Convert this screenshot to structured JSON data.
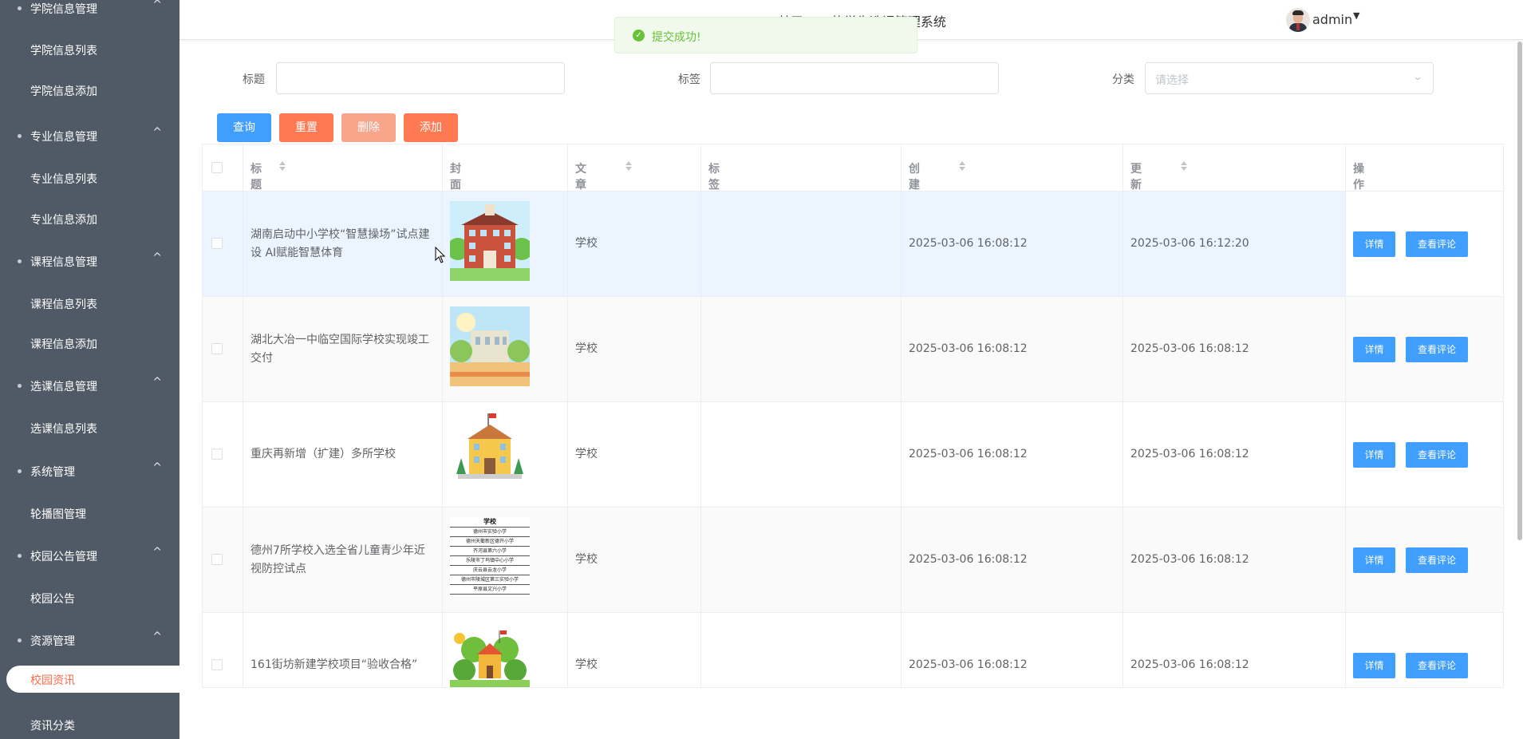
{
  "app": {
    "title": "基于Web的学生选课管理系统"
  },
  "user": {
    "name": "admin"
  },
  "toast": {
    "message": "提交成功!"
  },
  "sidebar": {
    "items": [
      {
        "type": "group",
        "label": "学院信息管理",
        "caret": "^"
      },
      {
        "type": "item",
        "label": "学院信息列表"
      },
      {
        "type": "item",
        "label": "学院信息添加"
      },
      {
        "type": "group",
        "label": "专业信息管理",
        "caret": "^"
      },
      {
        "type": "item",
        "label": "专业信息列表"
      },
      {
        "type": "item",
        "label": "专业信息添加"
      },
      {
        "type": "group",
        "label": "课程信息管理",
        "caret": "^"
      },
      {
        "type": "item",
        "label": "课程信息列表"
      },
      {
        "type": "item",
        "label": "课程信息添加"
      },
      {
        "type": "group",
        "label": "选课信息管理",
        "caret": "^"
      },
      {
        "type": "item",
        "label": "选课信息列表"
      },
      {
        "type": "group",
        "label": "系统管理",
        "caret": "^"
      },
      {
        "type": "item",
        "label": "轮播图管理"
      },
      {
        "type": "group",
        "label": "校园公告管理",
        "caret": "^"
      },
      {
        "type": "item",
        "label": "校园公告"
      },
      {
        "type": "group",
        "label": "资源管理",
        "caret": "^"
      },
      {
        "type": "item",
        "label": "校园资讯",
        "active": true
      },
      {
        "type": "item",
        "label": "资讯分类"
      }
    ]
  },
  "search": {
    "title_label": "标题",
    "title_value": "",
    "tag_label": "标签",
    "tag_value": "",
    "category_label": "分类",
    "category_placeholder": "请选择"
  },
  "buttons": {
    "query": "查询",
    "reset": "重置",
    "delete": "删除",
    "add": "添加"
  },
  "table": {
    "headers": {
      "title": "标题",
      "cover": "封面图",
      "category": "文章分类",
      "tag": "标签",
      "created": "创建时间",
      "updated": "更新时间",
      "ops": "操作"
    },
    "rows": [
      {
        "title": "湖南启动中小学校“智慧操场”试点建设 AI赋能智慧体育",
        "category": "学校",
        "tag": "",
        "created": "2025-03-06 16:08:12",
        "updated": "2025-03-06 16:12:20",
        "detail": "详情",
        "comments": "查看评论"
      },
      {
        "title": "湖北大冶一中临空国际学校实现竣工交付",
        "category": "学校",
        "tag": "",
        "created": "2025-03-06 16:08:12",
        "updated": "2025-03-06 16:08:12",
        "detail": "详情",
        "comments": "查看评论"
      },
      {
        "title": "重庆再新增（扩建）多所学校",
        "category": "学校",
        "tag": "",
        "created": "2025-03-06 16:08:12",
        "updated": "2025-03-06 16:08:12",
        "detail": "详情",
        "comments": "查看评论"
      },
      {
        "title": "德州7所学校入选全省儿童青少年近视防控试点",
        "category": "学校",
        "tag": "",
        "created": "2025-03-06 16:08:12",
        "updated": "2025-03-06 16:08:12",
        "detail": "详情",
        "comments": "查看评论"
      },
      {
        "title": "161街坊新建学校项目“验收合格”",
        "category": "学校",
        "tag": "",
        "created": "2025-03-06 16:08:12",
        "updated": "2025-03-06 16:08:12",
        "detail": "详情",
        "comments": "查看评论"
      }
    ],
    "thumb4": {
      "heading": "学校",
      "lines": [
        "德州市实验小学",
        "德州天衢新区德开小学",
        "齐河县第六小学",
        "乐陵市丁坞镇中心小学",
        "庆云县云龙小学",
        "德州市陵城区第三实验小学",
        "平原县文兴小学"
      ]
    }
  },
  "colors": {
    "sidebar": "#505a66",
    "primary": "#409eff",
    "accent": "#ff7a52",
    "success": "#67c23a"
  }
}
